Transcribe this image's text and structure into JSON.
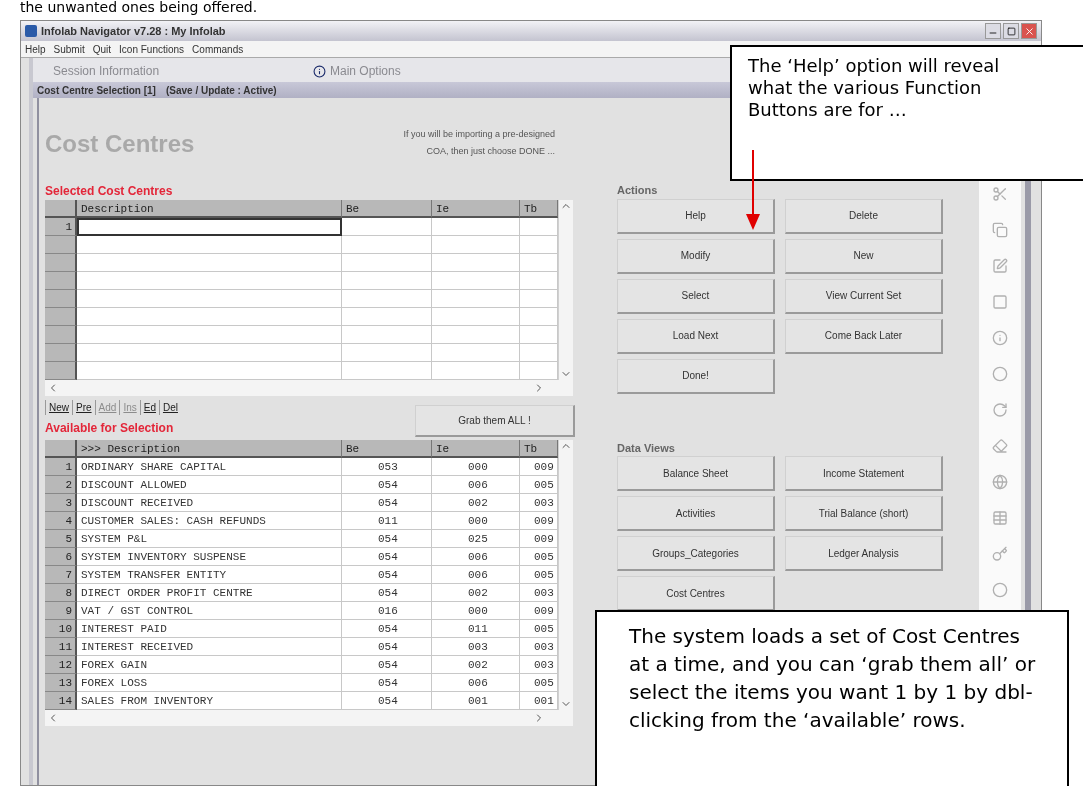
{
  "document_text": "the unwanted ones being offered.",
  "window": {
    "title": "Infolab Navigator v7.28 : My Infolab"
  },
  "menu": [
    "Help",
    "Submit",
    "Quit",
    "Icon Functions",
    "Commands"
  ],
  "tabs": [
    {
      "label": "Session Information",
      "selected": false
    },
    {
      "label": "Main Options",
      "selected": false
    }
  ],
  "form_bar": {
    "title": "Cost Centre Selection [1]",
    "status": "(Save / Update : Active)"
  },
  "heading": "Cost Centres",
  "hint": [
    "If you will be importing a pre-designed",
    "COA, then just choose DONE ..."
  ],
  "selected_table": {
    "title": "Selected Cost Centres",
    "columns": [
      "Description",
      "Be",
      "Ie",
      "Tb"
    ],
    "rows": [
      {
        "number": "1"
      }
    ]
  },
  "nav_links": [
    {
      "label": "New",
      "disabled": false
    },
    {
      "label": "Pre",
      "disabled": false
    },
    {
      "label": "Add",
      "disabled": true
    },
    {
      "label": "Ins",
      "disabled": true
    },
    {
      "label": "Ed",
      "disabled": false
    },
    {
      "label": "Del",
      "disabled": false
    }
  ],
  "grab_button": "Grab them ALL !",
  "available_table": {
    "title": "Available for Selection",
    "columns": [
      ">>> Description",
      "Be",
      "Ie",
      "Tb"
    ],
    "rows": [
      {
        "number": "1",
        "description": "ORDINARY SHARE CAPITAL",
        "be": "053",
        "ie": "000",
        "tb": "009"
      },
      {
        "number": "2",
        "description": "DISCOUNT ALLOWED",
        "be": "054",
        "ie": "006",
        "tb": "005"
      },
      {
        "number": "3",
        "description": "DISCOUNT RECEIVED",
        "be": "054",
        "ie": "002",
        "tb": "003"
      },
      {
        "number": "4",
        "description": "CUSTOMER SALES: CASH REFUNDS",
        "be": "011",
        "ie": "000",
        "tb": "009"
      },
      {
        "number": "5",
        "description": "SYSTEM  P&L",
        "be": "054",
        "ie": "025",
        "tb": "009"
      },
      {
        "number": "6",
        "description": "SYSTEM INVENTORY SUSPENSE",
        "be": "054",
        "ie": "006",
        "tb": "005"
      },
      {
        "number": "7",
        "description": "SYSTEM TRANSFER ENTITY",
        "be": "054",
        "ie": "006",
        "tb": "005"
      },
      {
        "number": "8",
        "description": "DIRECT ORDER PROFIT CENTRE",
        "be": "054",
        "ie": "002",
        "tb": "003"
      },
      {
        "number": "9",
        "description": "VAT / GST CONTROL",
        "be": "016",
        "ie": "000",
        "tb": "009"
      },
      {
        "number": "10",
        "description": "INTEREST PAID",
        "be": "054",
        "ie": "011",
        "tb": "005"
      },
      {
        "number": "11",
        "description": "INTEREST RECEIVED",
        "be": "054",
        "ie": "003",
        "tb": "003"
      },
      {
        "number": "12",
        "description": "FOREX GAIN",
        "be": "054",
        "ie": "002",
        "tb": "003"
      },
      {
        "number": "13",
        "description": "FOREX LOSS",
        "be": "054",
        "ie": "006",
        "tb": "005"
      },
      {
        "number": "14",
        "description": "SALES FROM INVENTORY",
        "be": "054",
        "ie": "001",
        "tb": "001"
      }
    ]
  },
  "actions": {
    "title": "Actions",
    "buttons": [
      "Help",
      "Delete",
      "Modify",
      "New",
      "Select",
      "View Current Set",
      "Load Next",
      "Come Back Later",
      "Done!"
    ]
  },
  "data_views": {
    "title": "Data Views",
    "buttons": [
      "Balance Sheet",
      "Income Statement",
      "Activities",
      "Trial Balance (short)",
      "Groups_Categories",
      "Ledger Analysis",
      "Cost Centres"
    ]
  },
  "callouts": [
    {
      "text": "The ‘Help’ option will reveal what the various Function Buttons are for …"
    },
    {
      "text": "The system loads a set of Cost Centres at a time, and you can ‘grab them all’ or select the items you want 1 by 1 by dbl-clicking from the ‘available’ rows."
    }
  ]
}
